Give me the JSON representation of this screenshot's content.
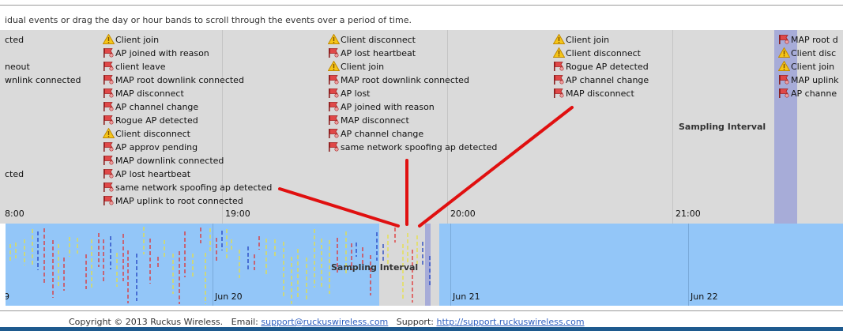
{
  "hint_text": "idual events or drag the day or hour bands to scroll through the events over a period of time.",
  "colors": {
    "warn": "#f1c40f",
    "alert": "#e04040",
    "hour_band_bg": "#dadada",
    "day_band_bg": "#93c6f8",
    "selection": "#a7acd8",
    "arrow": "#e01010"
  },
  "icons": {
    "warning": "warning-triangle-icon",
    "alert": "red-flag-alert-icon"
  },
  "hour_band": {
    "hour_labels": [
      "8:00",
      "19:00",
      "20:00",
      "21:00"
    ],
    "sampling_label": "Sampling Interval",
    "columns": [
      {
        "events": [
          {
            "icon": "none",
            "text": "cted"
          },
          {
            "icon": "none",
            "text": ""
          },
          {
            "icon": "none",
            "text": "neout"
          },
          {
            "icon": "none",
            "text": "wnlink connected"
          },
          {
            "icon": "none",
            "text": ""
          },
          {
            "icon": "none",
            "text": ""
          },
          {
            "icon": "none",
            "text": ""
          },
          {
            "icon": "none",
            "text": ""
          },
          {
            "icon": "none",
            "text": ""
          },
          {
            "icon": "none",
            "text": ""
          },
          {
            "icon": "none",
            "text": "cted"
          }
        ]
      },
      {
        "events": [
          {
            "icon": "warn",
            "text": "Client join"
          },
          {
            "icon": "alert",
            "text": "AP joined with reason"
          },
          {
            "icon": "alert",
            "text": "client leave"
          },
          {
            "icon": "alert",
            "text": "MAP root downlink connected"
          },
          {
            "icon": "alert",
            "text": "MAP disconnect"
          },
          {
            "icon": "alert",
            "text": "AP channel change"
          },
          {
            "icon": "alert",
            "text": "Rogue AP detected"
          },
          {
            "icon": "warn",
            "text": "Client disconnect"
          },
          {
            "icon": "alert",
            "text": "AP approv pending"
          },
          {
            "icon": "alert",
            "text": "MAP downlink connected"
          },
          {
            "icon": "alert",
            "text": "AP lost heartbeat"
          },
          {
            "icon": "alert",
            "text": "same network spoofing ap detected"
          },
          {
            "icon": "alert",
            "text": "MAP uplink to root connected"
          }
        ]
      },
      {
        "events": [
          {
            "icon": "warn",
            "text": "Client disconnect"
          },
          {
            "icon": "alert",
            "text": "AP lost heartbeat"
          },
          {
            "icon": "warn",
            "text": "Client join"
          },
          {
            "icon": "alert",
            "text": "MAP root downlink connected"
          },
          {
            "icon": "alert",
            "text": "AP lost"
          },
          {
            "icon": "alert",
            "text": "AP joined with reason"
          },
          {
            "icon": "alert",
            "text": "MAP disconnect"
          },
          {
            "icon": "alert",
            "text": "AP channel change"
          },
          {
            "icon": "alert",
            "text": "same network spoofing ap detected"
          }
        ]
      },
      {
        "events": [
          {
            "icon": "warn",
            "text": "Client join"
          },
          {
            "icon": "warn",
            "text": "Client disconnect"
          },
          {
            "icon": "alert",
            "text": "Rogue AP detected"
          },
          {
            "icon": "alert",
            "text": "AP channel change"
          },
          {
            "icon": "alert",
            "text": "MAP disconnect"
          }
        ]
      },
      {
        "events": [
          {
            "icon": "alert",
            "text": "MAP root d"
          },
          {
            "icon": "warn",
            "text": "Client disc"
          },
          {
            "icon": "warn",
            "text": "Client join"
          },
          {
            "icon": "alert",
            "text": "MAP uplink"
          },
          {
            "icon": "alert",
            "text": "AP channe"
          }
        ]
      }
    ]
  },
  "day_band": {
    "day_labels": [
      "Jun 20",
      "Jun 21",
      "Jun 22"
    ],
    "sampling_label": "Sampling Interval",
    "cut_label": "9"
  },
  "footer": {
    "copyright": "Copyright © 2013 Ruckus Wireless.",
    "email_label": "Email:",
    "email_link": "support@ruckuswireless.com",
    "support_label": "Support:",
    "support_link": "http://support.ruckuswireless.com"
  }
}
